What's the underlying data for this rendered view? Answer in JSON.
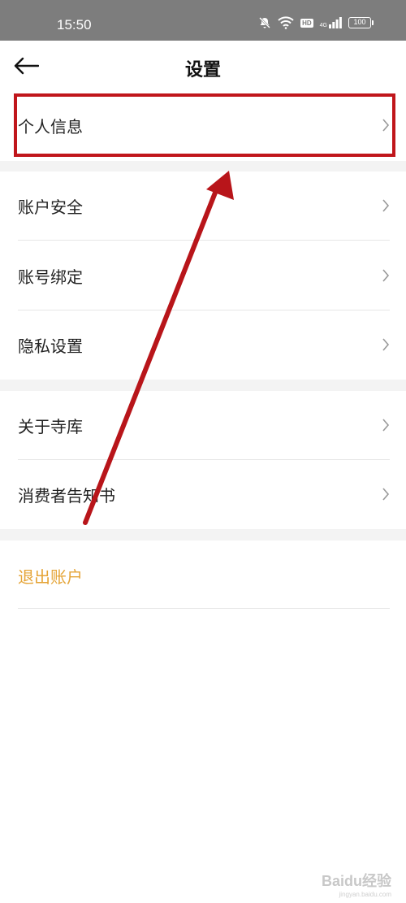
{
  "status_bar": {
    "time": "15:50",
    "network": "4G",
    "hd": "HD",
    "battery": "100"
  },
  "nav": {
    "title": "设置"
  },
  "sections": [
    {
      "items": [
        {
          "label": "个人信息"
        }
      ]
    },
    {
      "items": [
        {
          "label": "账户安全"
        },
        {
          "label": "账号绑定"
        },
        {
          "label": "隐私设置"
        }
      ]
    },
    {
      "items": [
        {
          "label": "关于寺库"
        },
        {
          "label": "消费者告知书"
        }
      ]
    }
  ],
  "logout": {
    "label": "退出账户",
    "color": "#e5a437"
  },
  "annotation": {
    "color": "#c0161b"
  },
  "watermark": {
    "text": "Baidu经验",
    "sub": "jingyan.baidu.com"
  }
}
